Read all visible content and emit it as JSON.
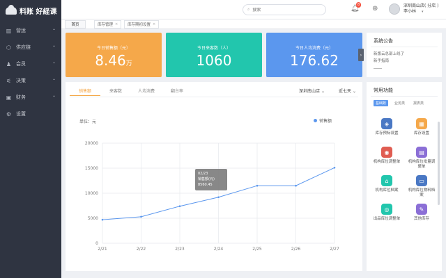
{
  "app": {
    "brand": "料账 好経课"
  },
  "sidebar": {
    "items": [
      {
        "icon": "chart-icon",
        "label": "营运",
        "glyph": "▥"
      },
      {
        "icon": "supply-icon",
        "label": "供应链",
        "glyph": "⬡"
      },
      {
        "icon": "member-icon",
        "label": "会员",
        "glyph": "♟"
      },
      {
        "icon": "decision-icon",
        "label": "决策",
        "glyph": "⚟"
      },
      {
        "icon": "finance-icon",
        "label": "财务",
        "glyph": "▣"
      },
      {
        "icon": "gear-icon",
        "label": "设置",
        "glyph": "⚙"
      }
    ]
  },
  "topbar": {
    "search_placeholder": "搜索",
    "notification_count": "8",
    "user_store": "深圳南山店( 分店 )",
    "user_name": "李小林"
  },
  "tabs": [
    {
      "label": "首页",
      "closable": false
    },
    {
      "label": "库存管理",
      "closable": true
    },
    {
      "label": "库存期初设置",
      "closable": true
    }
  ],
  "stats": [
    {
      "label": "今日销售额（元）",
      "value": "8.46",
      "unit": "万",
      "color": "#f5a84a"
    },
    {
      "label": "今日来客数（人）",
      "value": "1060",
      "unit": "",
      "color": "#22c6ad"
    },
    {
      "label": "今日人均消费（元）",
      "value": "176.62",
      "unit": "",
      "color": "#5b97ee"
    }
  ],
  "chart_panel": {
    "tabs": [
      "销售额",
      "来客数",
      "人均消费",
      "翻台率"
    ],
    "store_filter": "深圳南山店",
    "range_filter": "近七天",
    "unit_label": "单位：元"
  },
  "tooltip": {
    "date": "02/23",
    "series": "销售额(元)",
    "value": "8560.45"
  },
  "chart_data": {
    "type": "line",
    "x": [
      "2/21",
      "2/22",
      "2/23",
      "2/24",
      "2/25",
      "2/26",
      "2/27"
    ],
    "series": [
      {
        "name": "销售额",
        "values": [
          4700,
          5300,
          7400,
          9200,
          11500,
          11500,
          15100
        ],
        "color": "#5b97ee"
      }
    ],
    "ylim": [
      0,
      20000
    ],
    "yticks": [
      0,
      5000,
      10000,
      15000,
      20000
    ],
    "grid": true,
    "legend": "top-right"
  },
  "notice": {
    "title": "系统公告",
    "lines": [
      "新版云总部上线了",
      "新手指南"
    ]
  },
  "common": {
    "title": "常用功能",
    "subtabs": [
      "基础数",
      "业务类",
      "报表类"
    ],
    "items": [
      {
        "label": "库存预标设置",
        "icon": "inventory-alert-icon",
        "color": "#4a78c4",
        "glyph": "◈"
      },
      {
        "label": "库存设置",
        "icon": "inventory-settings-icon",
        "color": "#f5a84a",
        "glyph": "▦"
      },
      {
        "label": "机构库位调整单",
        "icon": "adjust-icon",
        "color": "#e05d52",
        "glyph": "◉"
      },
      {
        "label": "机构库位批量调整单",
        "icon": "batch-adjust-icon",
        "color": "#8b6fd6",
        "glyph": "▤"
      },
      {
        "label": "机构库位档案",
        "icon": "archive-icon",
        "color": "#22c6ad",
        "glyph": "⌂"
      },
      {
        "label": "机构库位物料档案",
        "icon": "material-icon",
        "color": "#4a78c4",
        "glyph": "▭"
      },
      {
        "label": "出品库位调整单",
        "icon": "output-icon",
        "color": "#22c6ad",
        "glyph": "◎"
      },
      {
        "label": "其他库存",
        "icon": "other-icon",
        "color": "#8b6fd6",
        "glyph": "✎"
      }
    ]
  }
}
